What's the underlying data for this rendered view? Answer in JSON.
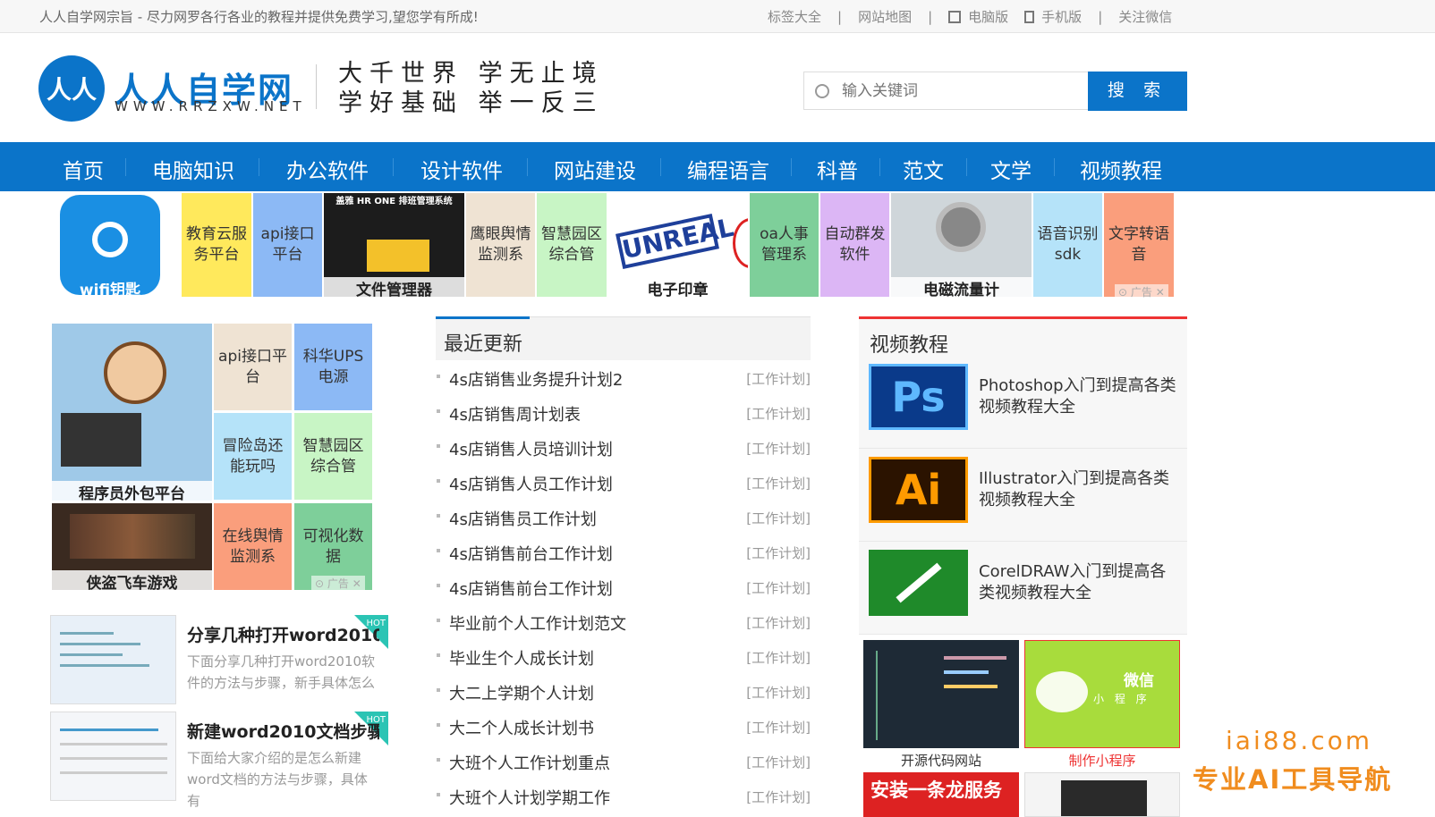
{
  "topbar": {
    "slogan": "人人自学网宗旨 - 尽力网罗各行各业的教程并提供免费学习,望您学有所成!",
    "links": [
      "标签大全",
      "网站地图",
      "电脑版",
      "手机版"
    ],
    "follow": "关注微信"
  },
  "header": {
    "logo_mark": "人人",
    "logo_name": "人人自学网",
    "logo_url": "WWW.RRZXW.NET",
    "motto_line1": "大千世界  学无止境",
    "motto_line2": "学好基础  举一反三",
    "search_placeholder": "输入关键词",
    "search_button": "搜 索"
  },
  "nav": [
    "首页",
    "电脑知识",
    "办公软件",
    "设计软件",
    "网站建设",
    "编程语言",
    "科普",
    "范文",
    "文学",
    "视频教程"
  ],
  "ads_top": {
    "wifi": "wifi钥匙",
    "t1": "教育云服务平台",
    "t2": "api接口平台",
    "file_header": "盖雅 HR ONE 排班管理系统",
    "file_caption": "文件管理器",
    "t3": "鹰眼舆情监测系",
    "t4": "智慧园区综合管",
    "stamp_word": "UNREAL",
    "stamp_caption": "电子印章",
    "t5": "oa人事管理系",
    "t6": "自动群发软件",
    "meter_caption": "电磁流量计",
    "t7": "语音识别sdk",
    "t8": "文字转语音",
    "ad_label": "广告"
  },
  "ads_left": {
    "programmer": "程序员外包平台",
    "t1": "api接口平台",
    "t2": "科华UPS电源",
    "t3": "冒险岛还能玩吗",
    "t4": "智慧园区综合管",
    "game": "侠盗飞车游戏",
    "t5": "在线舆情监测系",
    "t6": "可视化数据",
    "ad_label": "广告"
  },
  "articles": [
    {
      "title": "分享几种打开word2010",
      "desc": "下面分享几种打开word2010软件的方法与步骤，新手具体怎么",
      "badge": "HOT"
    },
    {
      "title": "新建word2010文档步骤",
      "desc": "下面给大家介绍的是怎么新建word文档的方法与步骤，具体有",
      "badge": "HOT"
    }
  ],
  "recent": {
    "title": "最近更新",
    "items": [
      {
        "title": "4s店销售业务提升计划2",
        "cat": "[工作计划]"
      },
      {
        "title": "4s店销售周计划表",
        "cat": "[工作计划]"
      },
      {
        "title": "4s店销售人员培训计划",
        "cat": "[工作计划]"
      },
      {
        "title": "4s店销售人员工作计划",
        "cat": "[工作计划]"
      },
      {
        "title": "4s店销售员工作计划",
        "cat": "[工作计划]"
      },
      {
        "title": "4s店销售前台工作计划",
        "cat": "[工作计划]"
      },
      {
        "title": "4s店销售前台工作计划",
        "cat": "[工作计划]"
      },
      {
        "title": "毕业前个人工作计划范文",
        "cat": "[工作计划]"
      },
      {
        "title": "毕业生个人成长计划",
        "cat": "[工作计划]"
      },
      {
        "title": "大二上学期个人计划",
        "cat": "[工作计划]"
      },
      {
        "title": "大二个人成长计划书",
        "cat": "[工作计划]"
      },
      {
        "title": "大班个人工作计划重点",
        "cat": "[工作计划]"
      },
      {
        "title": "大班个人计划学期工作",
        "cat": "[工作计划]"
      }
    ]
  },
  "videos": {
    "title": "视频教程",
    "items": [
      {
        "icon": "Ps",
        "text": "Photoshop入门到提高各类视频教程大全",
        "bg": "#0a3a8a",
        "fg": "#5eb8ff"
      },
      {
        "icon": "Ai",
        "text": "Illustrator入门到提高各类视频教程大全",
        "bg": "#2b1300",
        "fg": "#ff9a00"
      },
      {
        "icon": "",
        "text": "CorelDRAW入门到提高各类视频教程大全",
        "bg": "#1f8a2a",
        "fg": "#ffffff"
      }
    ]
  },
  "right_ads": {
    "code": "开源代码网站",
    "mini_top": "微信",
    "mini_sub": "小 程 序",
    "mini": "制作小程序",
    "bottom": "安装一条龙服务"
  },
  "watermark": {
    "line1": "iai88.com",
    "line2": "专业AI工具导航"
  }
}
